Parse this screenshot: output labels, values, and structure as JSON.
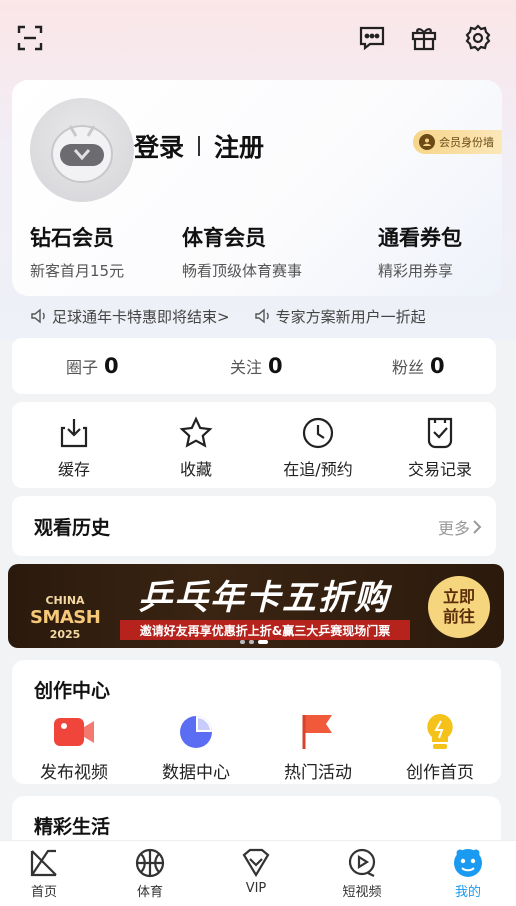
{
  "header": {
    "icons": [
      "scan-icon",
      "message-icon",
      "gift-icon",
      "settings-icon"
    ]
  },
  "profile": {
    "login_label": "登录",
    "register_label": "注册",
    "badge_label": "会员身份墙",
    "members": [
      {
        "title": "钻石会员",
        "subtitle": "新客首月15元"
      },
      {
        "title": "体育会员",
        "subtitle": "畅看顶级体育赛事"
      },
      {
        "title": "通看券包",
        "subtitle": "精彩用券享"
      }
    ]
  },
  "ticker": [
    {
      "text": "足球通年卡特惠即将结束>"
    },
    {
      "text": "专家方案新用户一折起"
    }
  ],
  "stats": [
    {
      "label": "圈子",
      "value": "0"
    },
    {
      "label": "关注",
      "value": "0"
    },
    {
      "label": "粉丝",
      "value": "0"
    }
  ],
  "tools": [
    {
      "label": "缓存",
      "icon": "download-icon"
    },
    {
      "label": "收藏",
      "icon": "star-icon"
    },
    {
      "label": "在追/预约",
      "icon": "clock-icon"
    },
    {
      "label": "交易记录",
      "icon": "trade-record-icon"
    }
  ],
  "history": {
    "title": "观看历史",
    "more": "更多"
  },
  "banner": {
    "logo_top": "CHINA",
    "logo_mid": "SMASH",
    "logo_year": "2025",
    "title": "乒乓年卡五折购",
    "subtitle": "邀请好友再享优惠折上折&赢三大乒赛现场门票",
    "cta_line1": "立即",
    "cta_line2": "前往"
  },
  "creation": {
    "title": "创作中心",
    "items": [
      {
        "label": "发布视频",
        "icon": "publish-video-icon",
        "color": "#f0453b"
      },
      {
        "label": "数据中心",
        "icon": "data-center-icon",
        "color": "#5b6df2"
      },
      {
        "label": "热门活动",
        "icon": "flag-icon",
        "color": "#f05a3a"
      },
      {
        "label": "创作首页",
        "icon": "lightbulb-icon",
        "color": "#f5c21b"
      }
    ]
  },
  "life": {
    "title": "精彩生活"
  },
  "tabbar": [
    {
      "label": "首页",
      "icon": "home-icon"
    },
    {
      "label": "体育",
      "icon": "basketball-icon"
    },
    {
      "label": "VIP",
      "icon": "vip-icon"
    },
    {
      "label": "短视频",
      "icon": "short-video-icon"
    },
    {
      "label": "我的",
      "icon": "mine-icon",
      "active": true
    }
  ],
  "colors": {
    "accent": "#1a9af0",
    "badge": "#f7d58a",
    "banner_red": "#b6231d"
  }
}
